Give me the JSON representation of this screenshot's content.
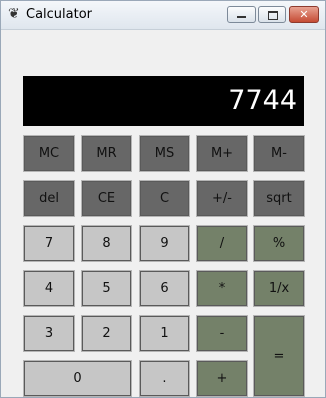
{
  "window": {
    "title": "Calculator",
    "icon": "feather-icon",
    "controls": {
      "close": "✕"
    }
  },
  "display": {
    "value": "7744"
  },
  "keys": {
    "mc": "MC",
    "mr": "MR",
    "ms": "MS",
    "mplus": "M+",
    "mminus": "M-",
    "del": "del",
    "ce": "CE",
    "c": "C",
    "plusminus": "+/-",
    "sqrt": "sqrt",
    "d7": "7",
    "d8": "8",
    "d9": "9",
    "divide": "/",
    "percent": "%",
    "d4": "4",
    "d5": "5",
    "d6": "6",
    "multiply": "*",
    "reciprocal": "1/x",
    "d3": "3",
    "d2": "2",
    "d1": "1",
    "subtract": "-",
    "equals": "=",
    "d0": "0",
    "decimal": ".",
    "add": "+"
  },
  "colors": {
    "memory_keys": "#676767",
    "digit_keys": "#c6c6c6",
    "operator_keys": "#748169",
    "display_bg": "#000000",
    "display_text": "#ffffff"
  }
}
